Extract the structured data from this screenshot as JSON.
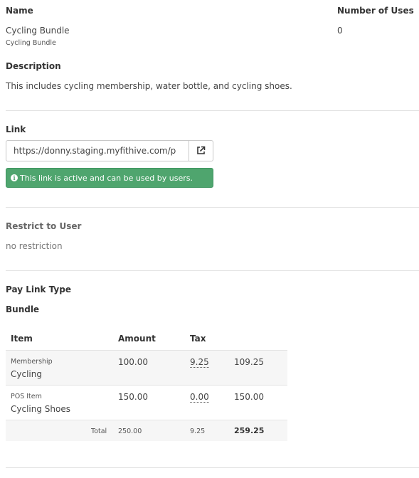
{
  "details": {
    "name_label": "Name",
    "name_value": "Cycling Bundle",
    "name_sub": "Cycling Bundle",
    "uses_label": "Number of Uses",
    "uses_value": "0",
    "description_label": "Description",
    "description_value": "This includes cycling membership, water bottle, and cycling shoes."
  },
  "link": {
    "label": "Link",
    "url": "https://donny.staging.myfithive.com/p",
    "open_icon": "external-link-icon",
    "status_icon": "info-icon",
    "status_text": "This link is active and can be used by users.",
    "status_color": "#4fa56e"
  },
  "restrict": {
    "label": "Restrict to User",
    "value": "no restriction"
  },
  "pay_link": {
    "type_label": "Pay Link Type",
    "type_value": "Bundle"
  },
  "table": {
    "headers": [
      "Item",
      "Amount",
      "Tax",
      ""
    ],
    "rows": [
      {
        "category": "Membership",
        "name": "Cycling",
        "amount": "100.00",
        "tax": "9.25",
        "total": "109.25"
      },
      {
        "category": "POS Item",
        "name": "Cycling Shoes",
        "amount": "150.00",
        "tax": "0.00",
        "total": "150.00"
      }
    ],
    "footer": {
      "label": "Total",
      "amount": "250.00",
      "tax": "9.25",
      "total": "259.25"
    }
  }
}
